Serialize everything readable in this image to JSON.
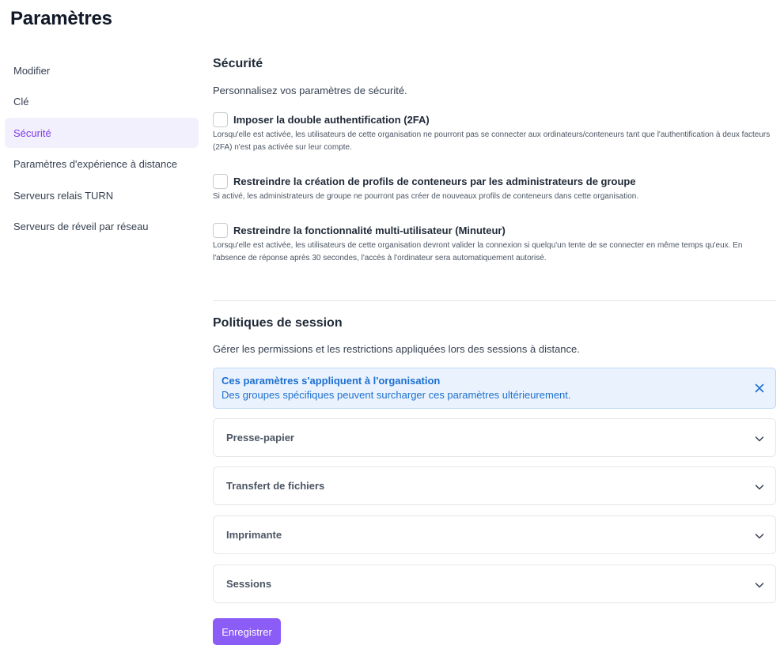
{
  "page": {
    "title": "Paramètres"
  },
  "sidebar": {
    "items": [
      {
        "label": "Modifier",
        "active": false
      },
      {
        "label": "Clé",
        "active": false
      },
      {
        "label": "Sécurité",
        "active": true
      },
      {
        "label": "Paramètres d'expérience à distance",
        "active": false
      },
      {
        "label": "Serveurs relais TURN",
        "active": false
      },
      {
        "label": "Serveurs de réveil par réseau",
        "active": false
      }
    ]
  },
  "security": {
    "title": "Sécurité",
    "description": "Personnalisez vos paramètres de sécurité.",
    "options": [
      {
        "label": "Imposer la double authentification (2FA)",
        "help": "Lorsqu'elle est activée, les utilisateurs de cette organisation ne pourront pas se connecter aux ordinateurs/conteneurs tant que l'authentification à deux facteurs (2FA) n'est pas activée sur leur compte.",
        "checked": false
      },
      {
        "label": "Restreindre la création de profils de conteneurs par les administrateurs de groupe",
        "help": "Si activé, les administrateurs de groupe ne pourront pas créer de nouveaux profils de conteneurs dans cette organisation.",
        "checked": false
      },
      {
        "label": "Restreindre la fonctionnalité multi-utilisateur (Minuteur)",
        "help": "Lorsqu'elle est activée, les utilisateurs de cette organisation devront valider la connexion si quelqu'un tente de se connecter en même temps qu'eux. En l'absence de réponse après 30 secondes, l'accès à l'ordinateur sera automatiquement autorisé.",
        "checked": false
      }
    ]
  },
  "session": {
    "title": "Politiques de session",
    "description": "Gérer les permissions et les restrictions appliquées lors des sessions à distance.",
    "alert": {
      "title": "Ces paramètres s'appliquent à l'organisation",
      "text": "Des groupes spécifiques peuvent surcharger ces paramètres ultérieurement."
    },
    "accordions": [
      {
        "label": "Presse-papier"
      },
      {
        "label": "Transfert de fichiers"
      },
      {
        "label": "Imprimante"
      },
      {
        "label": "Sessions"
      }
    ]
  },
  "actions": {
    "save_label": "Enregistrer"
  },
  "colors": {
    "accent": "#8b5cf6",
    "active_nav_bg": "#f3f0fd",
    "alert_bg": "#eaf3fd",
    "alert_text": "#1d6fd1"
  }
}
